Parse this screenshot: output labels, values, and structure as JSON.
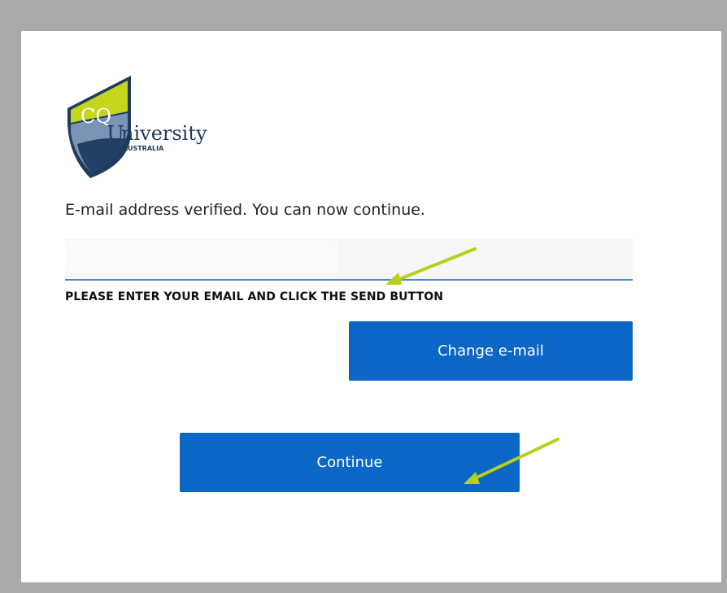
{
  "brand": {
    "logo_mark": "CQ",
    "logo_word": "niversity",
    "logo_initial": "U",
    "logo_sub": "AUSTRALIA"
  },
  "status_message": "E-mail address verified. You can now continue.",
  "email_input": {
    "value": "",
    "placeholder": ""
  },
  "instruction_text": "PLEASE ENTER YOUR EMAIL AND CLICK THE SEND BUTTON",
  "buttons": {
    "change_email": "Change e-mail",
    "continue": "Continue"
  },
  "colors": {
    "button_blue": "#0a67c5",
    "arrow_green": "#b8cf1b",
    "input_underline": "#4a86c8",
    "backdrop": "#a9a9a9"
  },
  "icons": [
    "university-logo",
    "pointer-arrow",
    "pointer-arrow"
  ]
}
